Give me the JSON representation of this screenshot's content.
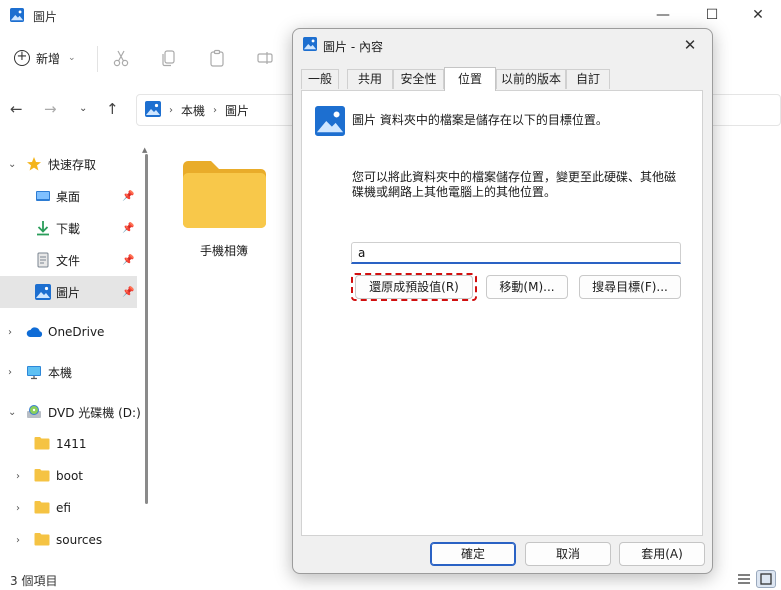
{
  "explorer": {
    "window_title": "圖片",
    "controls": {
      "minimize": "—",
      "maximize": "☐",
      "close": "✕"
    },
    "cmdbar": {
      "new_label": "新增"
    },
    "address": {
      "seg1": "本機",
      "seg2": "圖片",
      "separator": "›"
    },
    "sidebar": {
      "quick_access": "快速存取",
      "desktop": "桌面",
      "downloads": "下載",
      "documents": "文件",
      "pictures": "圖片",
      "onedrive": "OneDrive",
      "this_pc": "本機",
      "dvd": "DVD 光碟機 (D:)",
      "f1411": "1411",
      "boot": "boot",
      "efi": "efi",
      "sources": "sources"
    },
    "content": {
      "folder_label": "手機相簿"
    },
    "status": {
      "count": "3 個項目"
    }
  },
  "dialog": {
    "title": "圖片 - 內容",
    "close_glyph": "✕",
    "tabs": [
      "一般",
      "共用",
      "安全性",
      "位置",
      "以前的版本",
      "自訂"
    ],
    "location": {
      "desc": "圖片 資料夾中的檔案是儲存在以下的目標位置。",
      "text": "您可以將此資料夾中的檔案儲存位置，變更至此硬碟、其他磁碟機或網路上其他電腦上的其他位置。",
      "path_value": "a",
      "restore_label": "還原成預設值(R)",
      "move_label": "移動(M)...",
      "find_label": "搜尋目標(F)..."
    },
    "buttons": {
      "ok": "確定",
      "cancel": "取消",
      "apply": "套用(A)"
    }
  },
  "colors": {
    "accent": "#2a62c4",
    "highlight": "#d10f0f",
    "folder": "#f5c343"
  }
}
